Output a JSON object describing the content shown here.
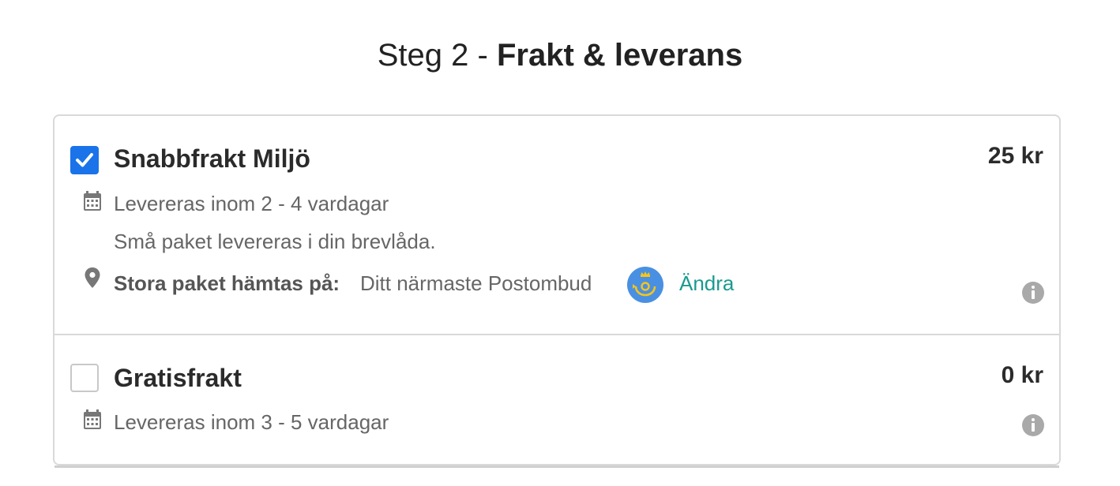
{
  "step": {
    "prefix": "Steg 2 - ",
    "title": "Frakt & leverans"
  },
  "options": [
    {
      "name": "Snabbfrakt Miljö",
      "price": "25 kr",
      "selected": true,
      "delivery_time": "Levereras inom 2 - 4 vardagar",
      "note": "Små paket levereras i din brevlåda.",
      "pickup_label": "Stora paket hämtas på:",
      "pickup_value": "Ditt närmaste Postombud",
      "change_label": "Ändra"
    },
    {
      "name": "Gratisfrakt",
      "price": "0 kr",
      "selected": false,
      "delivery_time": "Levereras inom 3 - 5 vardagar"
    }
  ],
  "colors": {
    "checkbox_checked": "#1a73e8",
    "link": "#1a9a8f",
    "postnord_blue": "#4a90e2",
    "postnord_yellow": "#f5c518"
  },
  "icons": {
    "calendar": "calendar-icon",
    "location": "map-pin-icon",
    "info": "info-icon",
    "check": "check-icon",
    "carrier_logo": "postnord-logo"
  }
}
